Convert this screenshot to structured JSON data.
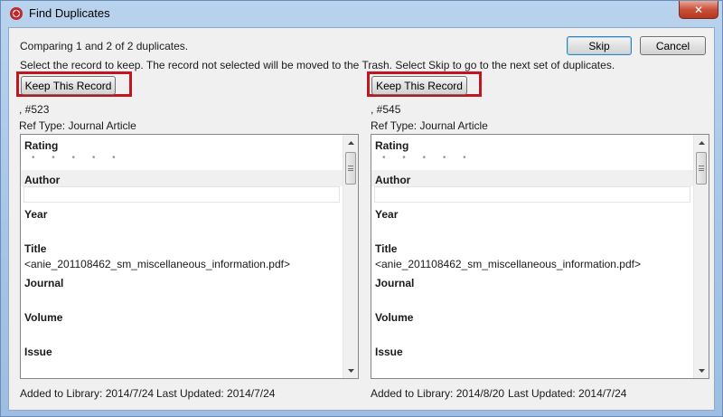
{
  "window": {
    "title": "Find Duplicates",
    "close_glyph": "✕"
  },
  "header": {
    "comparing": "Comparing 1 and 2 of 2 duplicates.",
    "instructions": "Select the record to keep. The record not selected will be moved to the Trash. Select Skip to go to the next set of duplicates.",
    "skip_label": "Skip",
    "cancel_label": "Cancel"
  },
  "records": [
    {
      "keep_label": "Keep This Record",
      "id_line": ", #523",
      "ref_type": "Ref Type: Journal Article",
      "fields": {
        "rating_label": "Rating",
        "rating_dots": "• • • • •",
        "author_label": "Author",
        "year_label": "Year",
        "title_label": "Title",
        "title_value": "<anie_201108462_sm_miscellaneous_information.pdf>",
        "journal_label": "Journal",
        "volume_label": "Volume",
        "issue_label": "Issue"
      },
      "added": "Added to Library: 2014/7/24",
      "updated": "Last Updated: 2014/7/24"
    },
    {
      "keep_label": "Keep This Record",
      "id_line": ", #545",
      "ref_type": "Ref Type: Journal Article",
      "fields": {
        "rating_label": "Rating",
        "rating_dots": "• • • • •",
        "author_label": "Author",
        "year_label": "Year",
        "title_label": "Title",
        "title_value": "<anie_201108462_sm_miscellaneous_information.pdf>",
        "journal_label": "Journal",
        "volume_label": "Volume",
        "issue_label": "Issue"
      },
      "added": "Added to Library: 2014/8/20",
      "updated": "Last Updated: 2014/7/24"
    }
  ],
  "colors": {
    "highlight": "#c3151e",
    "title_bar": "#b9d3ee",
    "close_button": "#c8513a"
  }
}
